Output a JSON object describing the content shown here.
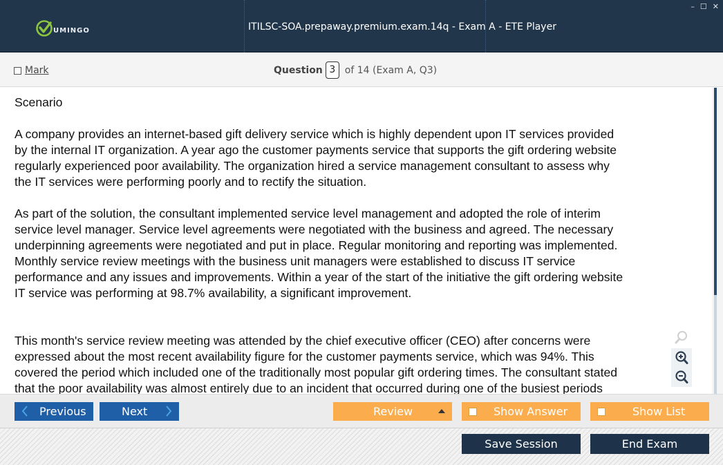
{
  "app": {
    "logo_text": "UMINGO",
    "window_title": "ITILSC-SOA.prepaway.premium.exam.14q - Exam A - ETE Player",
    "controls": [
      "–",
      "☐",
      "✕"
    ]
  },
  "question_header": {
    "mark_label": "Mark",
    "question_label": "Question",
    "question_number": "3",
    "question_suffix": "of 14 (Exam A, Q3)"
  },
  "content": {
    "paragraphs": [
      "Scenario",
      "A company provides an internet-based gift delivery service which is highly dependent upon IT services provided\nby the internal IT organization. A year ago the customer payments service that supports the gift ordering website\nregularly experienced poor availability. The organization hired a service management consultant to assess why\nthe IT services were performing poorly and to rectify the situation.",
      "As part of the solution, the consultant implemented service level management and adopted the role of interim\nservice level manager. Service level agreements were negotiated with the business and agreed. The necessary\nunderpinning agreements were negotiated and put in place. Regular monitoring and reporting was implemented.\nMonthly service review meetings with the business unit managers were established to discuss IT service\nperformance and any issues and improvements. Within a year of the start of the initiative the gift ordering website\nIT service was performing at 98.7% availability, a significant improvement.",
      "This month's service review meeting was attended by the chief executive officer (CEO) after concerns were\nexpressed about the most recent availability figure for the customer payments service, which was 94%. This\ncovered the period which included one of the traditionally most popular gift ordering times. The consultant stated\nthat the poor availability was almost entirely due to an incident that occurred during one of the busiest periods"
    ]
  },
  "zoom": {
    "reset_icon": "magnifier-icon",
    "in_icon": "zoom-in-icon",
    "out_icon": "zoom-out-icon"
  },
  "nav": {
    "previous_label": "Previous",
    "next_label": "Next",
    "review_label": "Review",
    "show_answer_label": "Show Answer",
    "show_list_label": "Show List"
  },
  "footer": {
    "save_label": "Save Session",
    "end_label": "End Exam"
  },
  "colors": {
    "titlebar": "#22364b",
    "primary_blue": "#1f5fa8",
    "orange": "#fbad4e",
    "dark_button": "#1e3349",
    "logo_green": "#8cc63f"
  }
}
